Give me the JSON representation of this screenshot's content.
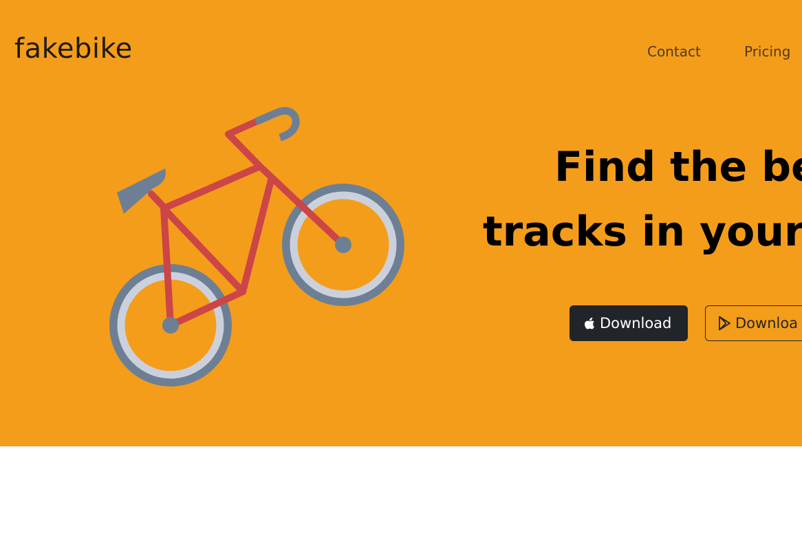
{
  "header": {
    "brand": "fakebike",
    "nav": [
      {
        "label": "Contact"
      },
      {
        "label": "Pricing"
      }
    ]
  },
  "hero": {
    "headline_line1": "Find the be",
    "headline_line2": "tracks in your",
    "buttons": {
      "apple_label": "Download",
      "play_label": "Downloa"
    },
    "colors": {
      "background": "#f49d1b",
      "frame": "#cc4547",
      "wheel": "#6d7f95",
      "rim": "#cbd1dc",
      "dark_button": "#212529"
    },
    "icons": {
      "apple": "apple-icon",
      "play": "google-play-icon",
      "illustration": "bicycle-illustration"
    }
  }
}
